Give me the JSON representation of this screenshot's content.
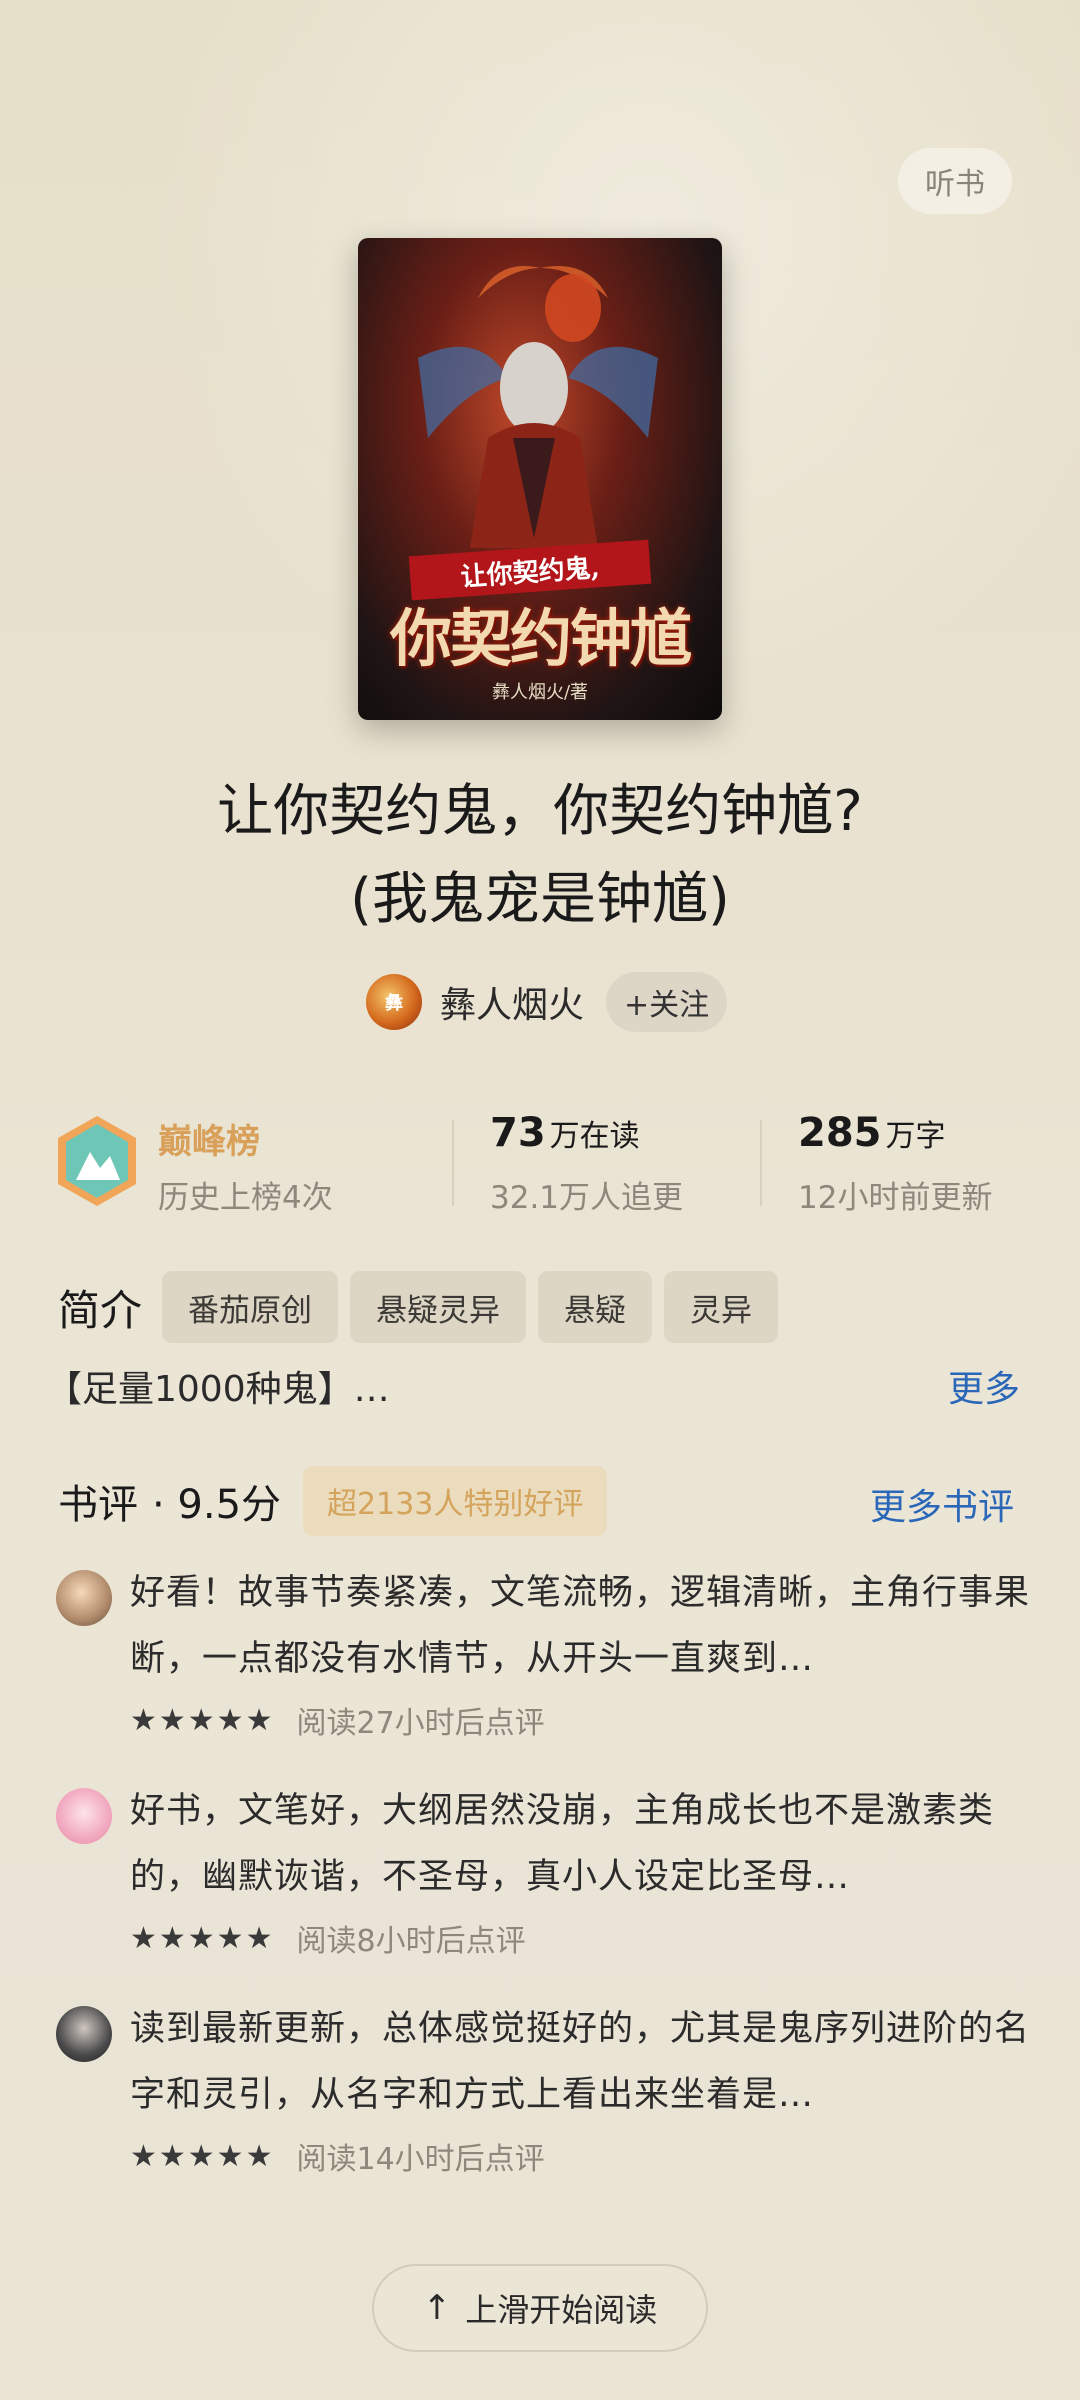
{
  "header": {
    "listen_label": "听书"
  },
  "book": {
    "cover": {
      "subtitle": "让你契约鬼,",
      "main": "你契约钟馗",
      "author": "彝人烟火/著"
    },
    "title_line1": "让你契约鬼，你契约钟馗?",
    "title_line2": "(我鬼宠是钟馗)",
    "author_name": "彝人烟火",
    "follow_label": "+关注"
  },
  "stats": {
    "rank_title": "巅峰榜",
    "rank_sub": "历史上榜4次",
    "readers_value": "73",
    "readers_unit": "万在读",
    "followers": "32.1万人追更",
    "words_value": "285",
    "words_unit": "万字",
    "updated": "12小时前更新"
  },
  "intro": {
    "label": "简介",
    "tags": [
      "番茄原创",
      "悬疑灵异",
      "悬疑",
      "灵异"
    ],
    "synopsis": "【足量1000种鬼】…",
    "more_label": "更多"
  },
  "reviews_section": {
    "label": "书评",
    "score": "· 9.5分",
    "badge": "超2133人特别好评",
    "more_label": "更多书评",
    "items": [
      {
        "text": "好看！故事节奏紧凑，文笔流畅，逻辑清晰，主角行事果断，一点都没有水情节，从开头一直爽到…",
        "stars": "★★★★★",
        "time": "阅读27小时后点评"
      },
      {
        "text": "好书，文笔好，大纲居然没崩，主角成长也不是激素类的，幽默诙谐，不圣母，真小人设定比圣母…",
        "stars": "★★★★★",
        "time": "阅读8小时后点评"
      },
      {
        "text": "读到最新更新，总体感觉挺好的，尤其是鬼序列进阶的名字和灵引，从名字和方式上看出来坐着是…",
        "stars": "★★★★★",
        "time": "阅读14小时后点评"
      }
    ]
  },
  "footer": {
    "start_label": "上滑开始阅读",
    "start_icon": "arrow-up-icon"
  }
}
